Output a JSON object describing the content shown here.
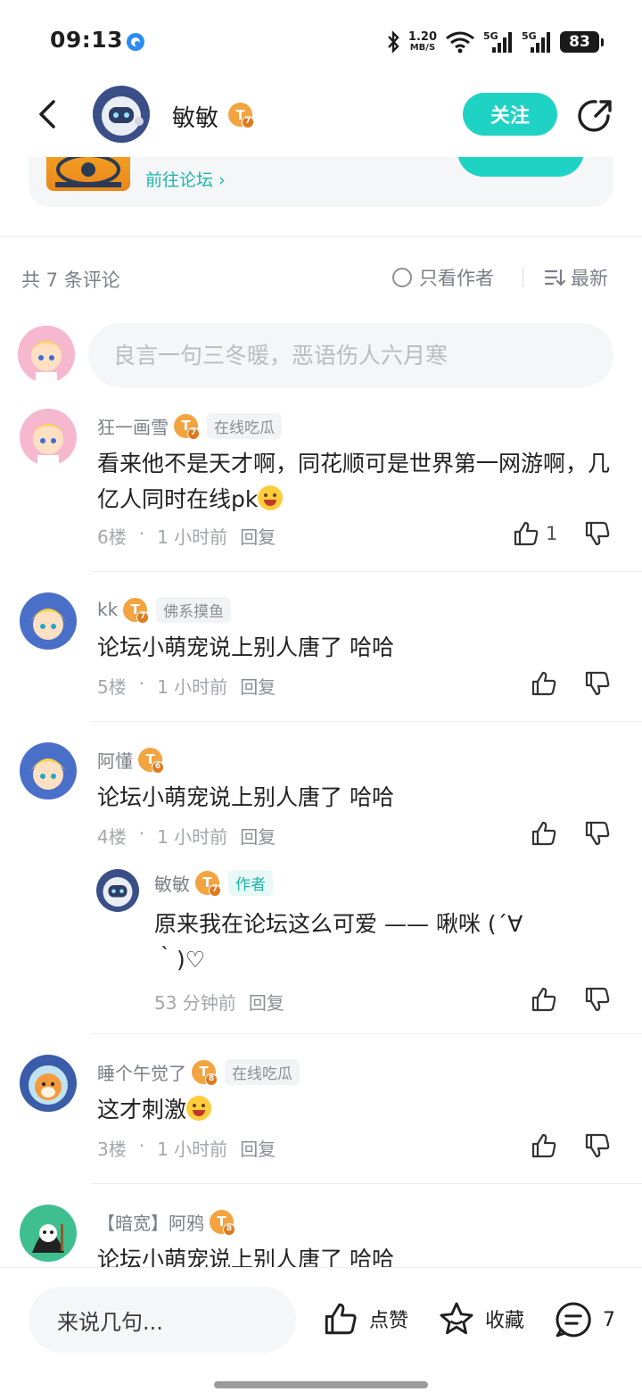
{
  "status_bar": {
    "time": "09:13",
    "net_speed_value": "1.20",
    "net_speed_unit": "MB/S",
    "signal1": "5G",
    "signal2": "5G",
    "battery": "83"
  },
  "header": {
    "username": "敏敏",
    "level": "7",
    "follow_label": "关注"
  },
  "forum_card": {
    "link_label": "前往论坛"
  },
  "comments_header": {
    "count_label": "共 7 条评论",
    "only_author_label": "只看作者",
    "sort_label": "最新"
  },
  "compose": {
    "placeholder": "良言一句三冬暖，恶语伤人六月寒"
  },
  "comments": [
    {
      "name": "狂一画雪",
      "level": "7",
      "tag": "在线吃瓜",
      "text": "看来他不是天才啊，同花顺可是世界第一网游啊，几亿人同时在线pk",
      "floor": "6楼",
      "time": "1 小时前",
      "reply_label": "回复",
      "likes": "1"
    },
    {
      "name": "kk",
      "level": "7",
      "tag": "佛系摸鱼",
      "text": "论坛小萌宠说上别人唐了 哈哈",
      "floor": "5楼",
      "time": "1 小时前",
      "reply_label": "回复"
    },
    {
      "name": "阿懂",
      "level": "6",
      "text": "论坛小萌宠说上别人唐了 哈哈",
      "floor": "4楼",
      "time": "1 小时前",
      "reply_label": "回复",
      "reply": {
        "name": "敏敏",
        "level": "7",
        "tag": "作者",
        "text": "原来我在论坛这么可爱 —— 啾咪 (´∀｀)♡",
        "time": "53 分钟前",
        "reply_label": "回复"
      }
    },
    {
      "name": "睡个午觉了",
      "level": "8",
      "tag": "在线吃瓜",
      "text": "这才刺激",
      "floor": "3楼",
      "time": "1 小时前",
      "reply_label": "回复"
    },
    {
      "name": "【暗宽】阿鸦",
      "level": "8",
      "text": "论坛小萌宠说上别人唐了 哈哈"
    }
  ],
  "bottom_bar": {
    "input_placeholder": "来说几句...",
    "like_label": "点赞",
    "favorite_label": "收藏",
    "comment_count": "7"
  },
  "colors": {
    "accent": "#1fd3c4",
    "badge": "#f3a33f",
    "muted_text": "#7a7f87"
  }
}
